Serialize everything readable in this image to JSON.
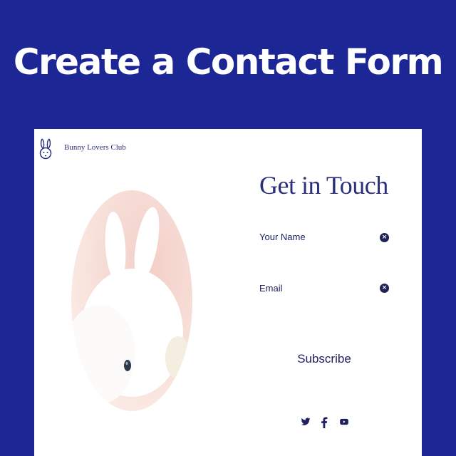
{
  "headline": "Create a Contact Form",
  "card": {
    "brand": "Bunny Lovers Club",
    "title": "Get in Touch",
    "fields": [
      {
        "label": "Your Name",
        "value": ""
      },
      {
        "label": "Email",
        "value": ""
      }
    ],
    "subscribe_label": "Subscribe",
    "social_icons": [
      "twitter-icon",
      "facebook-icon",
      "youtube-icon"
    ]
  },
  "colors": {
    "background": "#1c2694",
    "card": "#ffffff",
    "accent": "#2b2f7a",
    "text": "#1e2060"
  }
}
